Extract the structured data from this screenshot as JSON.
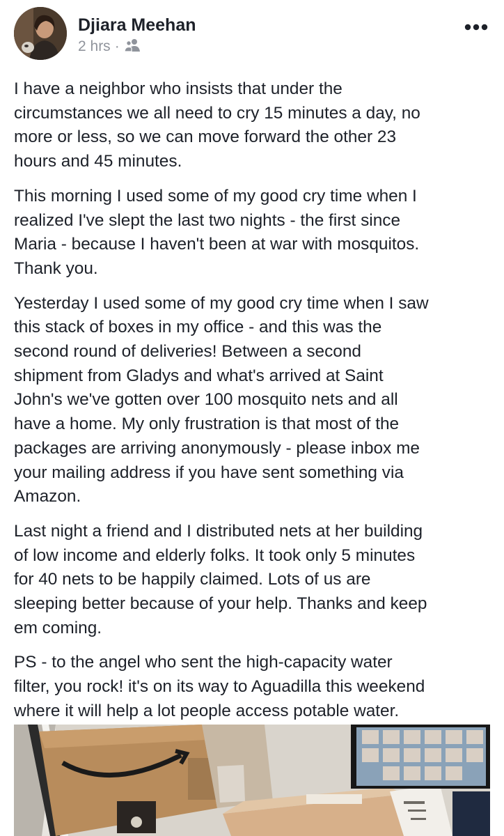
{
  "post": {
    "author": "Djiara Meehan",
    "time": "2 hrs",
    "separator": "·",
    "audience_icon": "friends-icon",
    "more_icon": "more-options-icon",
    "paragraphs": [
      [
        "I have a neighbor who insists that under the",
        "circumstances we all need to cry 15 minutes a day, no",
        "more or less, so we can move forward the other 23",
        "hours and 45 minutes."
      ],
      [
        "This morning I used some of my good cry time when I",
        "realized I've slept the last two nights - the first since",
        "Maria - because I haven't been at war with mosquitos.",
        "Thank you."
      ],
      [
        "Yesterday I used some of my good cry time when I saw",
        "this stack of boxes in my office - and this was the",
        "second round of deliveries! Between a second",
        "shipment from Gladys and what's arrived at Saint",
        "John's we've gotten over 100 mosquito nets and all",
        "have a home. My only frustration is that most of the",
        "packages are arriving anonymously - please inbox me",
        "your mailing address if you have sent something via",
        "Amazon."
      ],
      [
        "Last night a friend and I distributed nets at her building",
        "of low income and elderly folks. It took only 5 minutes",
        "for 40 nets to be happily claimed. Lots of us are",
        "sleeping better because of your help. Thanks and keep",
        "em coming."
      ],
      [
        "PS - to the angel who sent the high-capacity water",
        "filter, you rock! it's on its way to Aguadilla this weekend",
        "where it will help a lot people access potable water."
      ]
    ]
  }
}
